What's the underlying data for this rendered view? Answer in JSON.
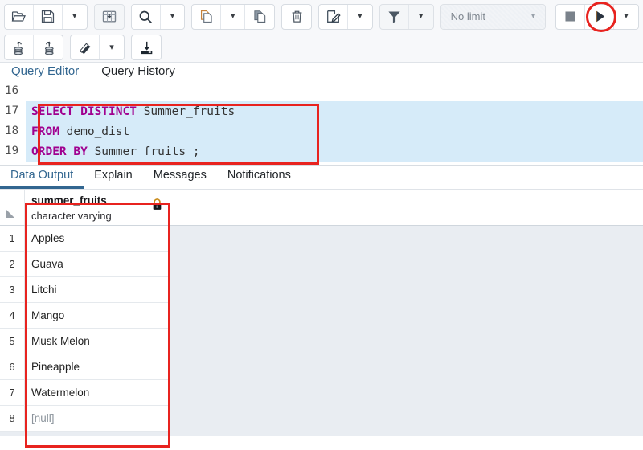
{
  "toolbar": {
    "groups": [
      {
        "name": "file-group",
        "buttons": [
          {
            "name": "open-file-button",
            "icon": "open-folder-icon",
            "label": ""
          },
          {
            "name": "save-file-button",
            "icon": "save-floppy-icon",
            "label": ""
          },
          {
            "name": "save-options-dropdown",
            "icon": "chevron-down-icon",
            "label": ""
          }
        ]
      },
      {
        "name": "edit-grid-group",
        "buttons": [
          {
            "name": "edit-grid-button",
            "icon": "grid-edit-icon",
            "label": ""
          }
        ]
      },
      {
        "name": "find-group",
        "buttons": [
          {
            "name": "find-button",
            "icon": "search-icon",
            "label": ""
          },
          {
            "name": "find-options-dropdown",
            "icon": "chevron-down-icon",
            "label": ""
          }
        ]
      },
      {
        "name": "clipboard-group",
        "buttons": [
          {
            "name": "copy-button",
            "icon": "copy-icon",
            "label": ""
          },
          {
            "name": "copy-options-dropdown",
            "icon": "chevron-down-icon",
            "label": ""
          },
          {
            "name": "paste-button",
            "icon": "paste-icon",
            "label": ""
          }
        ]
      },
      {
        "name": "delete-group",
        "buttons": [
          {
            "name": "delete-row-button",
            "icon": "trash-icon",
            "label": ""
          }
        ]
      },
      {
        "name": "filter-edit-group",
        "buttons": [
          {
            "name": "edit-query-button",
            "icon": "pencil-square-icon",
            "label": ""
          },
          {
            "name": "edit-query-dropdown",
            "icon": "chevron-down-icon",
            "label": ""
          }
        ]
      },
      {
        "name": "filter-group",
        "buttons": [
          {
            "name": "filter-button",
            "icon": "funnel-icon",
            "label": ""
          },
          {
            "name": "filter-options-dropdown",
            "icon": "chevron-down-icon",
            "label": ""
          }
        ]
      },
      {
        "name": "row-limit-group",
        "buttons": [
          {
            "name": "row-limit-select",
            "icon": "chevron-down-icon",
            "label": "No limit"
          }
        ]
      },
      {
        "name": "execute-group",
        "buttons": [
          {
            "name": "stop-query-button",
            "icon": "stop-square-icon",
            "label": ""
          },
          {
            "name": "execute-query-button",
            "icon": "play-triangle-icon",
            "label": ""
          },
          {
            "name": "execute-options-dropdown",
            "icon": "chevron-down-icon",
            "label": ""
          }
        ]
      }
    ],
    "row2_groups": [
      {
        "name": "transaction-group",
        "buttons": [
          {
            "name": "commit-button",
            "icon": "commit-database-icon",
            "label": ""
          },
          {
            "name": "rollback-button",
            "icon": "rollback-database-icon",
            "label": ""
          }
        ]
      },
      {
        "name": "clear-group",
        "buttons": [
          {
            "name": "clear-query-button",
            "icon": "eraser-icon",
            "label": ""
          },
          {
            "name": "clear-options-dropdown",
            "icon": "chevron-down-icon",
            "label": ""
          }
        ]
      },
      {
        "name": "download-group",
        "buttons": [
          {
            "name": "download-results-button",
            "icon": "download-icon",
            "label": ""
          }
        ]
      }
    ]
  },
  "editor_tabs": {
    "query_editor": "Query Editor",
    "query_history": "Query History"
  },
  "editor": {
    "lines": [
      {
        "number": "16",
        "selected": false,
        "tokens": []
      },
      {
        "number": "17",
        "selected": true,
        "tokens": [
          {
            "t": "SELECT DISTINCT ",
            "kw": true
          },
          {
            "t": "Summer_fruits",
            "kw": false
          }
        ]
      },
      {
        "number": "18",
        "selected": true,
        "tokens": [
          {
            "t": "FROM ",
            "kw": true
          },
          {
            "t": "demo_dist",
            "kw": false
          }
        ]
      },
      {
        "number": "19",
        "selected": true,
        "tokens": [
          {
            "t": "ORDER BY ",
            "kw": true
          },
          {
            "t": "Summer_fruits ;",
            "kw": false
          }
        ]
      }
    ],
    "full_query": "SELECT DISTINCT Summer_fruits FROM demo_dist ORDER BY Summer_fruits ;"
  },
  "output_tabs": {
    "data_output": "Data Output",
    "explain": "Explain",
    "messages": "Messages",
    "notifications": "Notifications"
  },
  "grid": {
    "column": {
      "name": "summer_fruits",
      "type": "character varying",
      "lock_icon": "lock-icon"
    },
    "rows": [
      {
        "num": "1",
        "value": "Apples",
        "is_null": false
      },
      {
        "num": "2",
        "value": "Guava",
        "is_null": false
      },
      {
        "num": "3",
        "value": "Litchi",
        "is_null": false
      },
      {
        "num": "4",
        "value": "Mango",
        "is_null": false
      },
      {
        "num": "5",
        "value": "Musk Melon",
        "is_null": false
      },
      {
        "num": "6",
        "value": "Pineapple",
        "is_null": false
      },
      {
        "num": "7",
        "value": "Watermelon",
        "is_null": false
      },
      {
        "num": "8",
        "value": "[null]",
        "is_null": true
      }
    ]
  },
  "annotations": {
    "execute_circle": {
      "name": "execute-button-highlight",
      "color": "#e8231f"
    },
    "query_rect": {
      "name": "query-text-highlight",
      "color": "#e8231f"
    },
    "results_rect": {
      "name": "results-column-highlight",
      "color": "#e8231f"
    }
  },
  "colors": {
    "accent": "#326690",
    "keyword": "#a0008f",
    "selection": "#d6ebf9",
    "annotation": "#e8231f",
    "grid_empty": "#e9edf2"
  }
}
